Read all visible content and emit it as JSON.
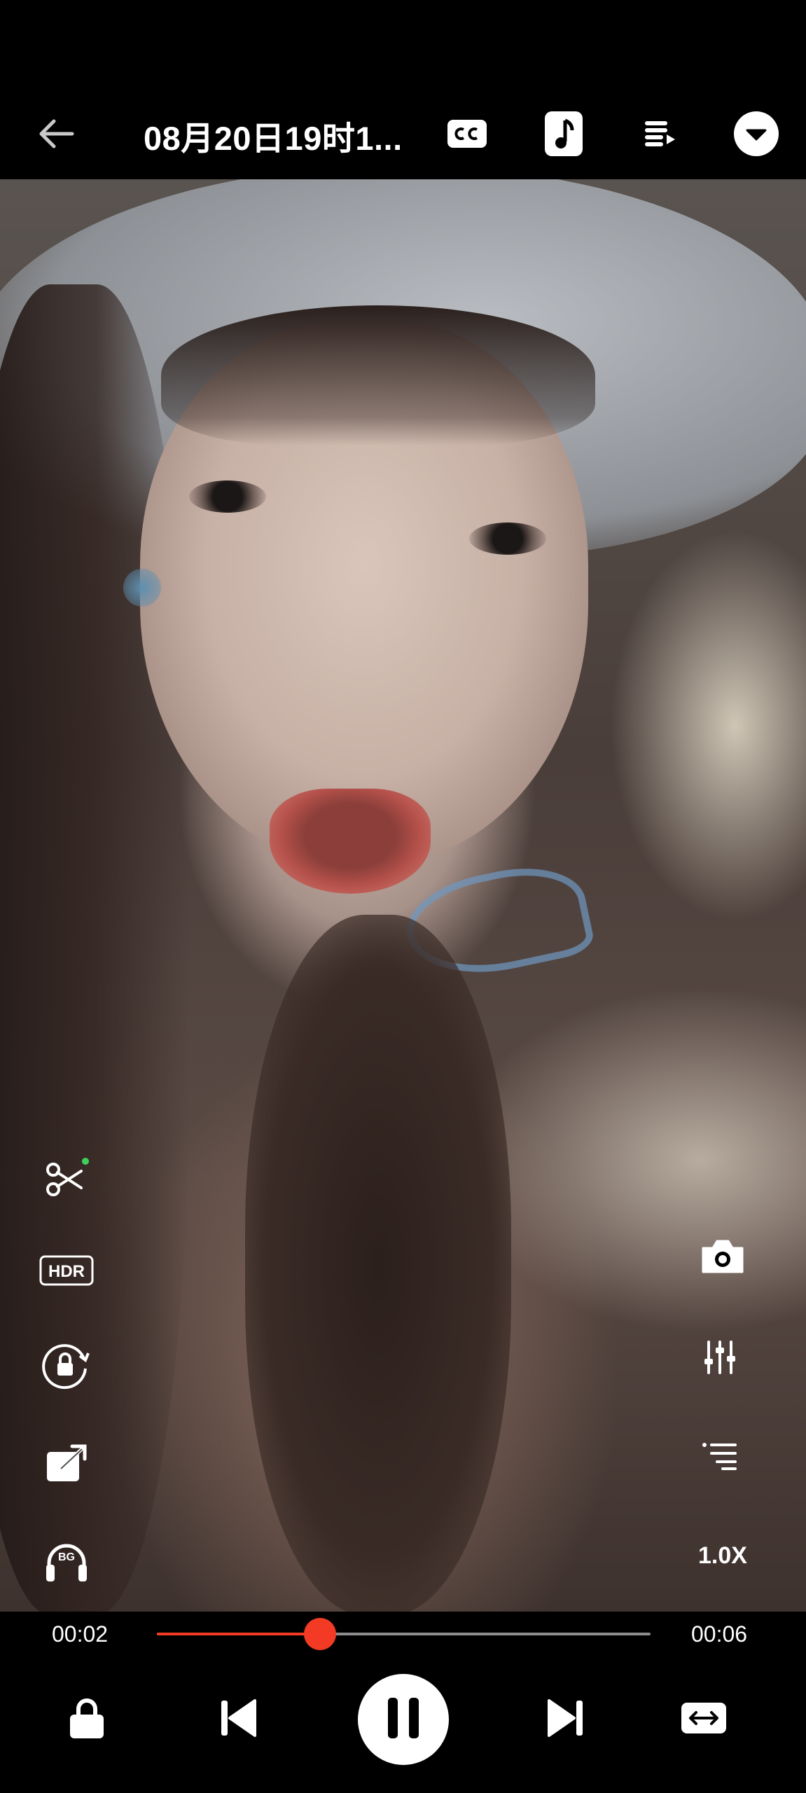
{
  "header": {
    "title": "08月20日19时1..."
  },
  "player": {
    "current_time": "00:02",
    "total_time": "00:06",
    "progress_fraction": 0.33,
    "speed_label": "1.0X"
  },
  "icons": {
    "back": "arrow-left-icon",
    "subtitles": "cc-icon",
    "audio": "music-note-icon",
    "playlist": "playlist-icon",
    "menu": "dropdown-circle-icon",
    "cut": "scissors-icon",
    "hdr": "hdr-icon",
    "rotate_lock": "rotation-lock-icon",
    "popout": "popout-icon",
    "background_play": "headphones-bg-icon",
    "screenshot": "camera-icon",
    "equalizer": "equalizer-icon",
    "chapters": "list-icon",
    "lock": "lock-icon",
    "previous": "skip-previous-icon",
    "pause": "pause-icon",
    "next": "skip-next-icon",
    "aspect": "aspect-ratio-icon"
  },
  "colors": {
    "accent": "#f23a25",
    "background": "#000000",
    "track": "#8d8d8d",
    "cut_dot": "#3ecf5a"
  }
}
